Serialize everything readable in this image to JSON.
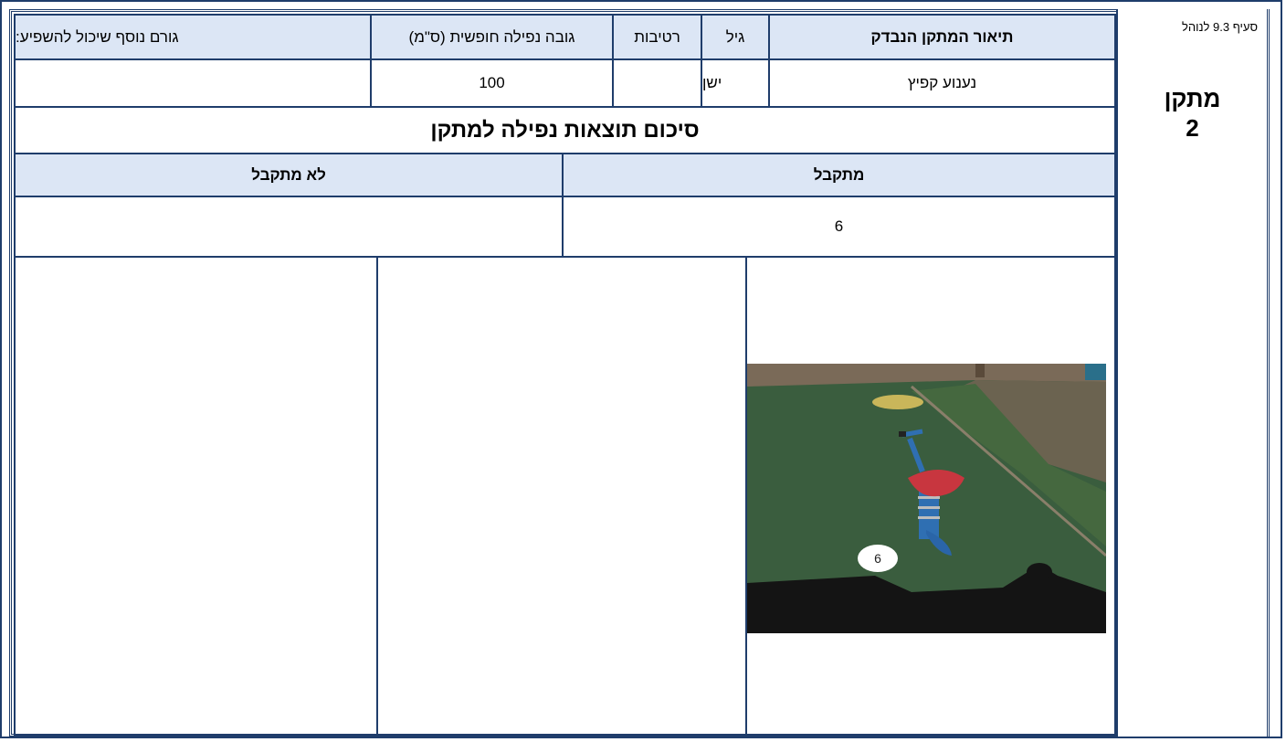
{
  "side": {
    "clause": "סעיף 9.3 לנוהל",
    "device_line1": "מתקן",
    "device_line2": "2"
  },
  "header": {
    "description": "תיאור המתקן הנבדק",
    "age": "גיל",
    "moisture": "רטיבות",
    "fall_height": "גובה נפילה חופשית (ס\"מ)",
    "other_factor": "גורם נוסף שיכול להשפיע:"
  },
  "row": {
    "description": "נענוע קפיץ",
    "age": "ישן",
    "moisture": "",
    "fall_height": "100",
    "other_factor": ""
  },
  "summary": {
    "title": "סיכום תוצאות נפילה למתקן"
  },
  "results": {
    "acceptable_label": "מתקבל",
    "not_acceptable_label": "לא מתקבל",
    "acceptable_value": "6",
    "not_acceptable_value": ""
  },
  "photo": {
    "marker_label": "6"
  }
}
